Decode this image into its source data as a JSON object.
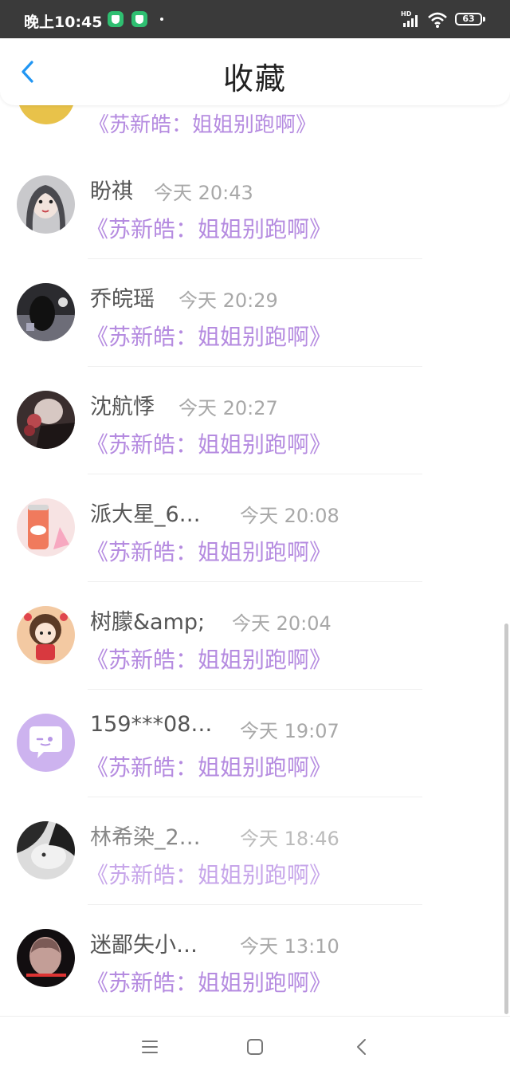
{
  "status_bar": {
    "time": "晚上10:45",
    "battery": "63",
    "network": "HD"
  },
  "header": {
    "title": "收藏",
    "back_icon": "chevron-left-icon"
  },
  "partial_item": {
    "title": "《苏新皓：姐姐别跑啊》"
  },
  "favorites": [
    {
      "name": "盼祺",
      "time": "今天 20:43",
      "title": "《苏新皓：姐姐别跑啊》",
      "avatar": "girl-portrait"
    },
    {
      "name": "乔皖瑶",
      "time": "今天 20:29",
      "title": "《苏新皓：姐姐别跑啊》",
      "avatar": "dark-figure"
    },
    {
      "name": "沈航悸",
      "time": "今天 20:27",
      "title": "《苏新皓：姐姐别跑啊》",
      "avatar": "roses"
    },
    {
      "name": "派大星_6…",
      "time": "今天 20:08",
      "title": "《苏新皓：姐姐别跑啊》",
      "avatar": "soda-can"
    },
    {
      "name": "树朦&amp;",
      "time": "今天 20:04",
      "title": "《苏新皓：姐姐别跑啊》",
      "avatar": "cartoon-girl"
    },
    {
      "name": "159***08…",
      "time": "今天 19:07",
      "title": "《苏新皓：姐姐别跑啊》",
      "avatar": "chat-bubble-default"
    },
    {
      "name": "林希染_2…",
      "time": "今天 18:46",
      "title": "《苏新皓：姐姐别跑啊》",
      "avatar": "cat"
    },
    {
      "name": "迷鄙失小…",
      "time": "今天 13:10",
      "title": "《苏新皓：姐姐别跑啊》",
      "avatar": "hands-face"
    }
  ],
  "nav": {
    "menu_icon": "menu-icon",
    "home_icon": "home-square-icon",
    "back_icon": "back-triangle-icon"
  },
  "colors": {
    "accent": "#2196f3",
    "title_purple": "#b58be0",
    "status_bar_bg": "#3a3a3a"
  }
}
